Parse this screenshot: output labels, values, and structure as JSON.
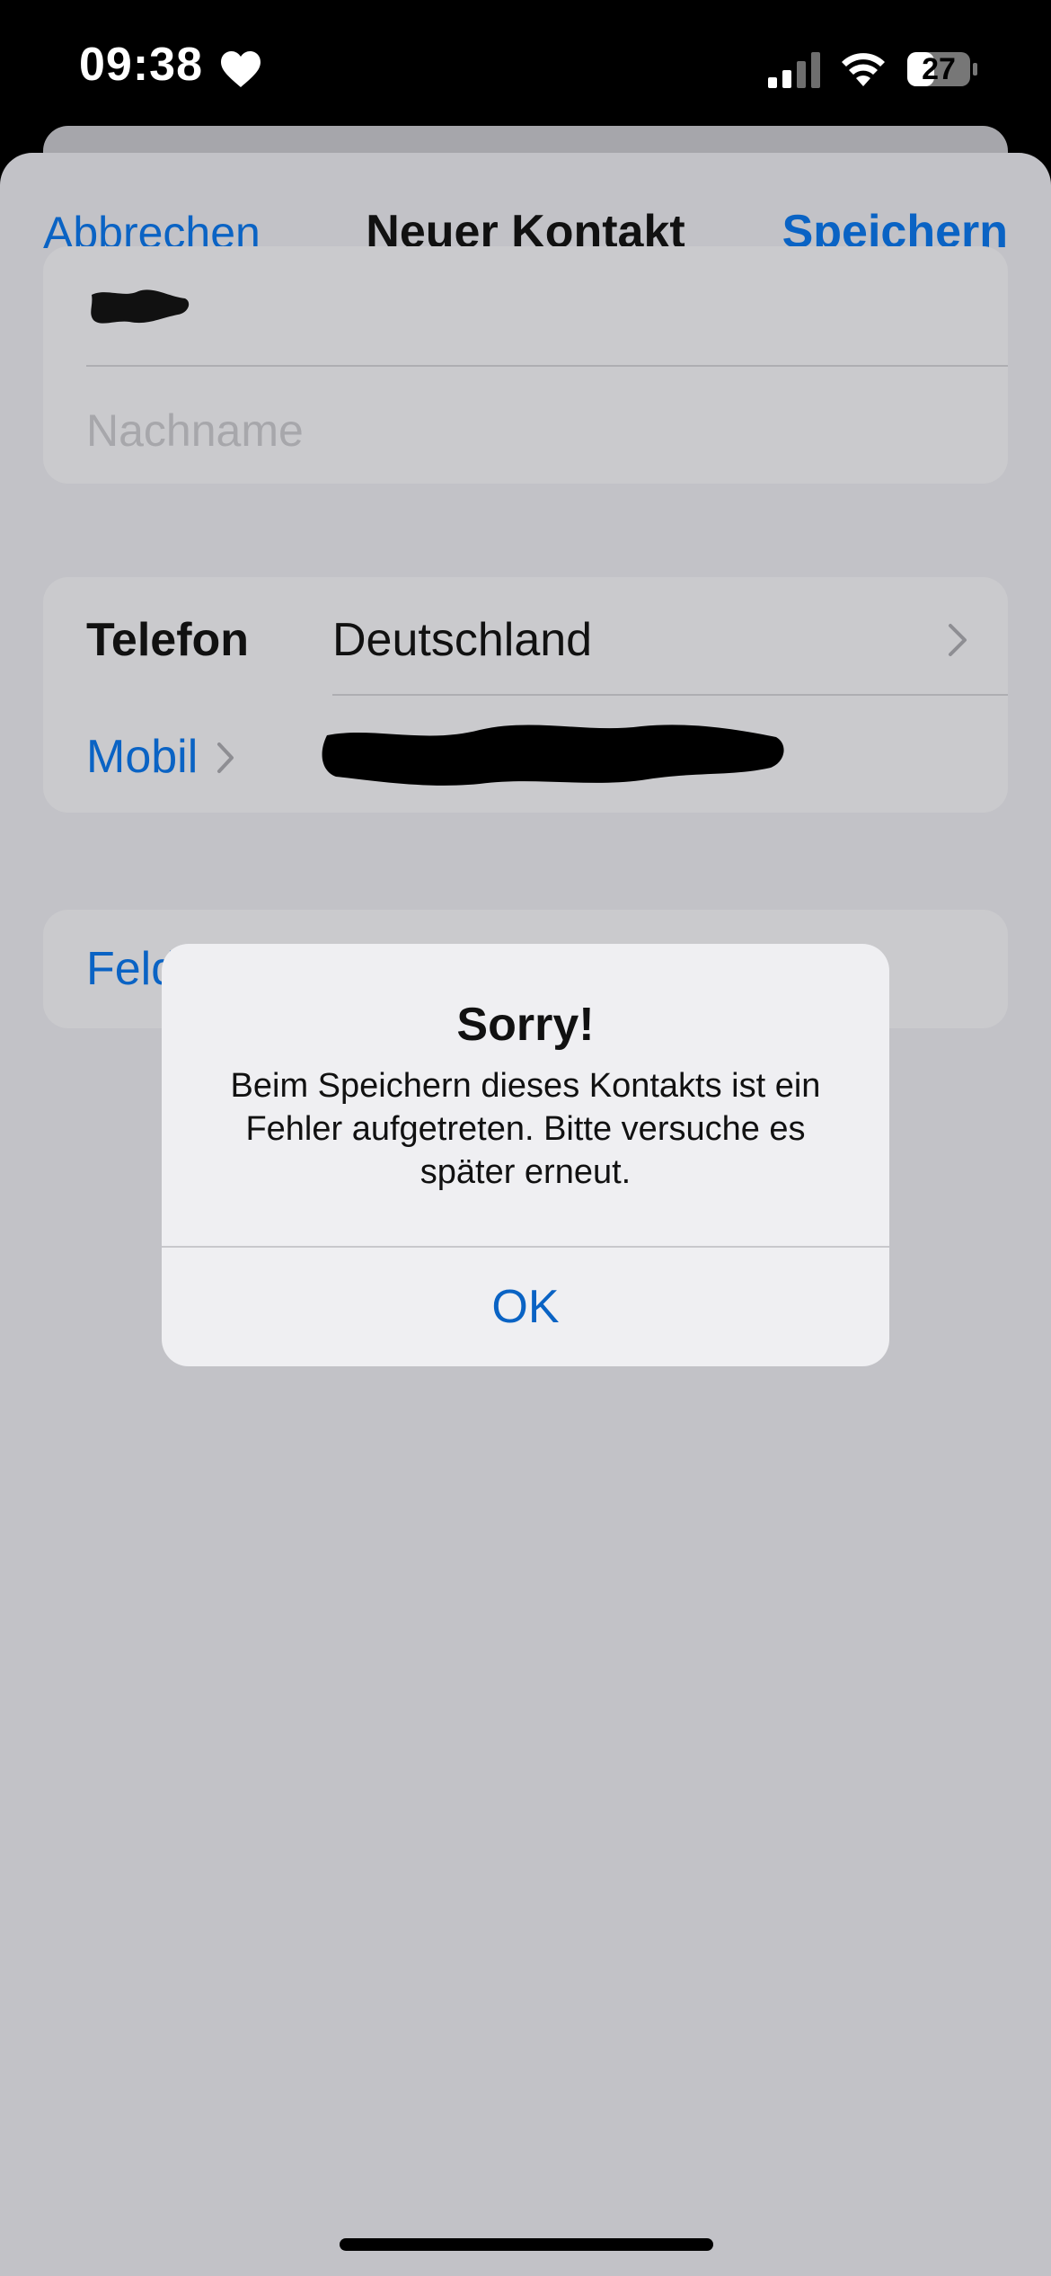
{
  "status_bar": {
    "time": "09:38",
    "battery_level": "27",
    "icons": [
      "heart-icon",
      "signal-icon",
      "wifi-icon",
      "battery-icon"
    ]
  },
  "nav": {
    "cancel_label": "Abbrechen",
    "title": "Neuer Kontakt",
    "save_label": "Speichern"
  },
  "name_group": {
    "last_name_placeholder": "Nachname"
  },
  "phone_group": {
    "label": "Telefon",
    "country": "Deutschland",
    "type_label": "Mobil"
  },
  "add_field": {
    "label": "Feld"
  },
  "alert": {
    "title": "Sorry!",
    "message": "Beim Speichern dieses Kontakts ist ein Fehler aufgetreten. Bitte versuche es später erneut.",
    "ok_label": "OK"
  },
  "colors": {
    "accent": "#0a63c4",
    "background": "#c2c2c7",
    "alert_background": "#efeff2"
  }
}
